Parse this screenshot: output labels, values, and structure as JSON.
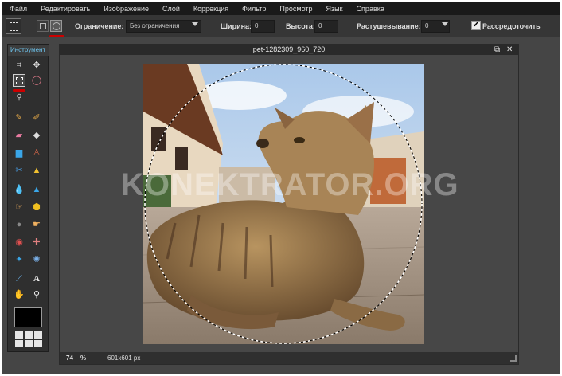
{
  "menu": [
    "Файл",
    "Редактировать",
    "Изображение",
    "Слой",
    "Коррекция",
    "Фильтр",
    "Просмотр",
    "Язык",
    "Справка"
  ],
  "options": {
    "constraint_label": "Ограничение:",
    "constraint_value": "Без ограничения",
    "width_label": "Ширина:",
    "width_value": "0",
    "height_label": "Высота:",
    "height_value": "0",
    "feather_label": "Растушевывание:",
    "feather_value": "0",
    "antialias_label": "Рассредоточить",
    "antialias_checked": "✔"
  },
  "tools": {
    "title": "Инструмент"
  },
  "document": {
    "title": "pet-1282309_960_720",
    "zoom": "74",
    "zoom_unit": "%",
    "dimensions": "601x601 px"
  },
  "watermark": "KONEKTRATOR.ORG",
  "colors": {
    "accent": "#6ec6f0",
    "highlight": "#cc0000",
    "menu_bg": "#1a1a1a",
    "workspace_bg": "#454545"
  }
}
